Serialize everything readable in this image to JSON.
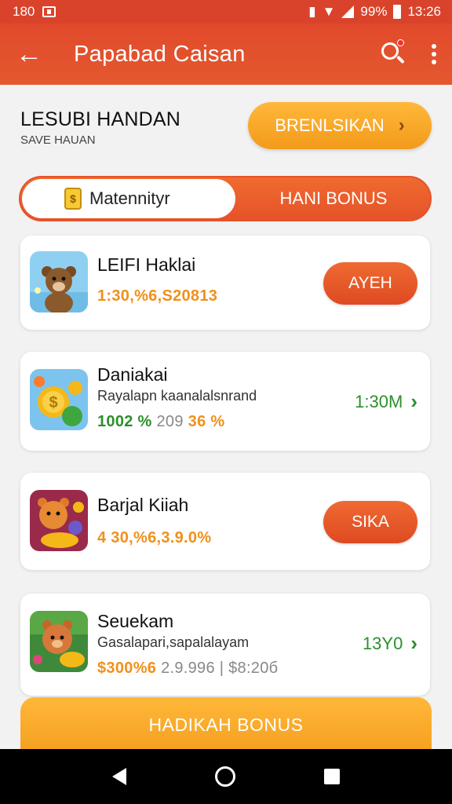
{
  "status_bar": {
    "left_text": "180",
    "battery_text": "99%",
    "time": "13:26"
  },
  "app_bar": {
    "title": "Papabad Caisan"
  },
  "header": {
    "title": "LESUBI HANDAN",
    "subtitle": "SAVE HAUAN",
    "cta_label": "BRENLSIKAN"
  },
  "tabs": {
    "active": "Matennityr",
    "inactive": "HANI BONUS"
  },
  "cards": [
    {
      "title": "LEIFI Haklai",
      "amount": "1:30,%6,S20813",
      "action_label": "AYEH"
    },
    {
      "title": "Daniakai",
      "subtitle": "Rayalapn kaanalalsnrand",
      "amount_a": "1002 %",
      "amount_b": "209",
      "amount_c": "36 %",
      "side_value": "1:30M"
    },
    {
      "title": "Barjal Kiiah",
      "amount": "4 30,%6,3.9.0%",
      "action_label": "SIKA"
    },
    {
      "title": "Seuekam",
      "subtitle": "Gasalapari,sapalalayam",
      "amount_a": "$300%6",
      "amount_b": "2.9.996 | $8:20б",
      "side_value": "13Y0"
    }
  ],
  "bottom_cta": {
    "label": "HADIKAH BONUS"
  },
  "colors": {
    "primary": "#e14a2c",
    "accent": "#f5a020",
    "green": "#2c8f2c"
  }
}
